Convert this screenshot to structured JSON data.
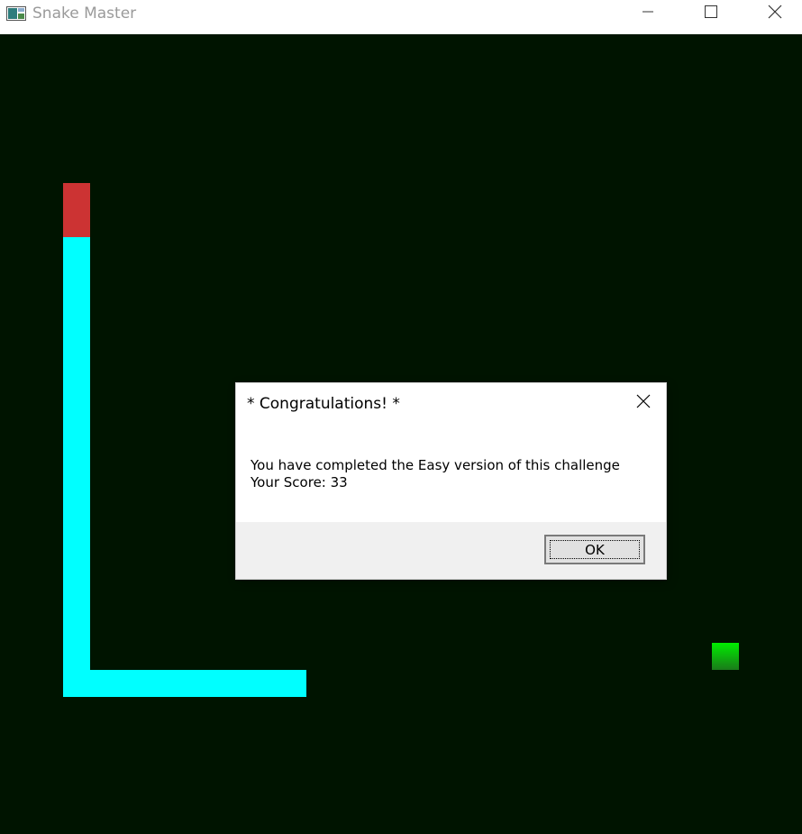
{
  "window": {
    "title": "Snake Master",
    "icon": "app-window-icon",
    "controls": [
      "minimize-icon",
      "maximize-icon",
      "close-icon"
    ]
  },
  "game": {
    "background_color": "#001400",
    "snake_head_color": "#cc3333",
    "snake_body_color": "#00ffff",
    "food_color": "#00cc00"
  },
  "dialog": {
    "title": "* Congratulations! *",
    "message_line1": "You have completed the Easy version of this challenge",
    "message_line2": "Your Score: 33",
    "ok_label": "OK",
    "close_icon": "close-icon"
  }
}
